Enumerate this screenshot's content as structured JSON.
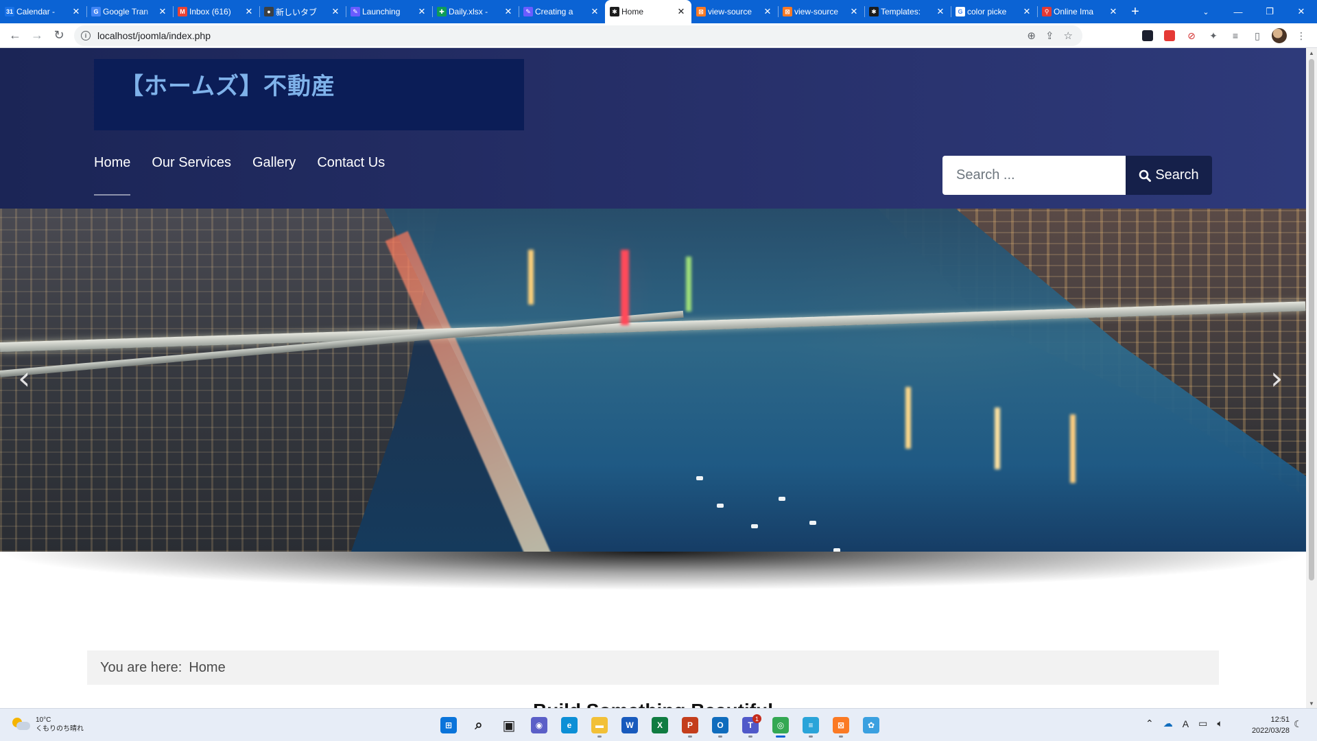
{
  "browser": {
    "tabs": [
      {
        "title": "Calendar - ",
        "icon": "calendar-icon",
        "color": "#1a73e8",
        "glyph": "31",
        "active": false
      },
      {
        "title": "Google Tran",
        "icon": "google-translate-icon",
        "color": "#4285f4",
        "glyph": "G",
        "active": false
      },
      {
        "title": "Inbox (616)",
        "icon": "gmail-icon",
        "color": "#ea4335",
        "glyph": "M",
        "active": false
      },
      {
        "title": "新しいタブ",
        "icon": "new-tab-icon",
        "color": "#3c4043",
        "glyph": "●",
        "active": false
      },
      {
        "title": "Launching",
        "icon": "pen-icon",
        "color": "#6a5cff",
        "glyph": "✎",
        "active": false
      },
      {
        "title": "Daily.xlsx - ",
        "icon": "sheets-icon",
        "color": "#0f9d58",
        "glyph": "✚",
        "active": false
      },
      {
        "title": "Creating a ",
        "icon": "pen-icon",
        "color": "#6a5cff",
        "glyph": "✎",
        "active": false
      },
      {
        "title": "Home",
        "icon": "joomla-icon",
        "color": "#1c1c1c",
        "glyph": "✱",
        "active": true
      },
      {
        "title": "view-source",
        "icon": "xampp-icon",
        "color": "#fb7a24",
        "glyph": "⊠",
        "active": false
      },
      {
        "title": "view-source",
        "icon": "xampp-icon",
        "color": "#fb7a24",
        "glyph": "⊠",
        "active": false
      },
      {
        "title": "Templates: ",
        "icon": "joomla-icon",
        "color": "#1c1c1c",
        "glyph": "✱",
        "active": false
      },
      {
        "title": "color picke",
        "icon": "google-icon",
        "color": "#ffffff",
        "glyph": "G",
        "active": false
      },
      {
        "title": "Online Ima",
        "icon": "pdf-icon",
        "color": "#e53935",
        "glyph": "⚲",
        "active": false
      }
    ],
    "new_tab_label": "+",
    "url": "localhost/joomla/index.php"
  },
  "site": {
    "brand_title": "【ホームズ】不動産",
    "nav": [
      {
        "label": "Home",
        "active": true
      },
      {
        "label": "Our Services",
        "active": false
      },
      {
        "label": "Gallery",
        "active": false
      },
      {
        "label": "Contact Us",
        "active": false
      }
    ],
    "search": {
      "placeholder": "Search ...",
      "button_label": "Search"
    },
    "carousel": {
      "prev_glyph": "‹",
      "next_glyph": "›"
    },
    "breadcrumb": {
      "prefix": "You are here:",
      "current": "Home"
    },
    "content_heading": "Build Something Beautiful"
  },
  "taskbar": {
    "weather": {
      "temp": "10°C",
      "condition": "くもりのち晴れ"
    },
    "clock": {
      "time": "12:51",
      "date": "2022/03/28"
    },
    "apps": [
      {
        "name": "start-icon",
        "color": "#0a74da",
        "glyph": "⊞",
        "running": false,
        "active": false
      },
      {
        "name": "search-icon",
        "color": "#e7edf7",
        "glyph": "⌕",
        "running": false,
        "active": false
      },
      {
        "name": "task-view-icon",
        "color": "#e7edf7",
        "glyph": "▣",
        "running": false,
        "active": false
      },
      {
        "name": "chat-icon",
        "color": "#5b5fc7",
        "glyph": "◉",
        "running": false,
        "active": false
      },
      {
        "name": "edge-icon",
        "color": "#0c8fd6",
        "glyph": "e",
        "running": false,
        "active": false
      },
      {
        "name": "file-explorer-icon",
        "color": "#f2c037",
        "glyph": "▬",
        "running": true,
        "active": false
      },
      {
        "name": "word-icon",
        "color": "#185abd",
        "glyph": "W",
        "running": false,
        "active": false
      },
      {
        "name": "excel-icon",
        "color": "#107c41",
        "glyph": "X",
        "running": false,
        "active": false
      },
      {
        "name": "powerpoint-icon",
        "color": "#c43e1c",
        "glyph": "P",
        "running": true,
        "active": false
      },
      {
        "name": "outlook-icon",
        "color": "#0f6cbd",
        "glyph": "O",
        "running": true,
        "active": false
      },
      {
        "name": "teams-icon",
        "color": "#5059c9",
        "glyph": "T",
        "running": true,
        "active": false,
        "badge": "1"
      },
      {
        "name": "chrome-icon",
        "color": "#34a853",
        "glyph": "◎",
        "running": true,
        "active": true
      },
      {
        "name": "notepad-icon",
        "color": "#2aa4d9",
        "glyph": "≡",
        "running": true,
        "active": false
      },
      {
        "name": "xampp-icon",
        "color": "#fb7a24",
        "glyph": "⊠",
        "running": true,
        "active": false
      },
      {
        "name": "globe-icon",
        "color": "#3aa0e0",
        "glyph": "✿",
        "running": false,
        "active": false
      }
    ]
  }
}
